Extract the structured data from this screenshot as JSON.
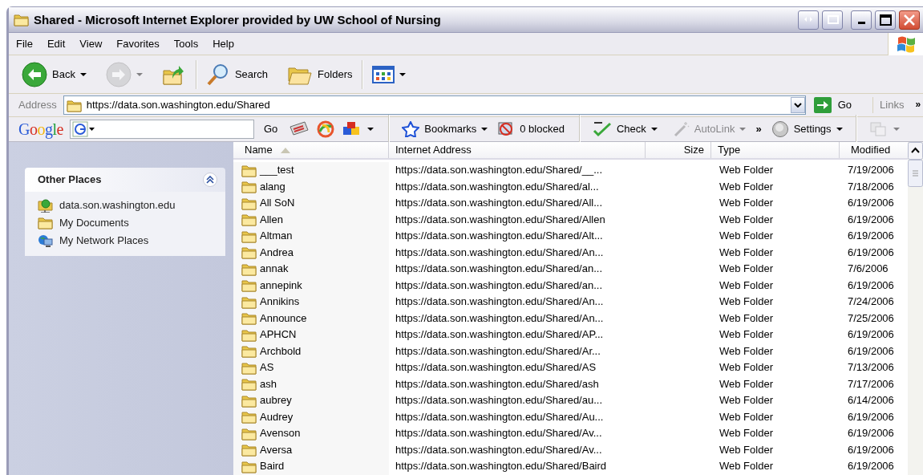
{
  "window": {
    "title": "Shared - Microsoft Internet Explorer provided by UW School of Nursing"
  },
  "menu": [
    {
      "label": "File"
    },
    {
      "label": "Edit"
    },
    {
      "label": "View"
    },
    {
      "label": "Favorites"
    },
    {
      "label": "Tools"
    },
    {
      "label": "Help"
    }
  ],
  "toolbar": {
    "groups": [
      {
        "buttons": [
          {
            "kind": "back",
            "label": "Back",
            "disabled": false,
            "dropdown": true
          },
          {
            "kind": "forward",
            "disabled": true,
            "dropdown": true
          },
          {
            "kind": "up",
            "disabled": false,
            "dropdown": false
          }
        ]
      },
      {
        "buttons": [
          {
            "kind": "search",
            "label": "Search",
            "disabled": false,
            "dropdown": false
          },
          {
            "kind": "folders",
            "label": "Folders",
            "disabled": false,
            "dropdown": false
          }
        ]
      },
      {
        "buttons": [
          {
            "kind": "views",
            "disabled": false,
            "dropdown": true
          }
        ]
      }
    ]
  },
  "address": {
    "label": "Address",
    "value": "https://data.son.washington.edu/Shared",
    "go": "Go",
    "links": "Links",
    "more": "»"
  },
  "google": {
    "logo": "Google",
    "go": "Go",
    "items": [
      {
        "kind": "bookmarks",
        "label": "Bookmarks",
        "disabled": false,
        "dropdown": true
      },
      {
        "kind": "blocked",
        "label": "0 blocked",
        "disabled": false,
        "dropdown": false
      },
      {
        "kind": "check",
        "label": "Check",
        "disabled": false,
        "dropdown": true
      },
      {
        "kind": "autolink",
        "label": "AutoLink",
        "disabled": true,
        "dropdown": true
      },
      {
        "kind": "more",
        "label": "»",
        "disabled": false,
        "dropdown": false
      },
      {
        "kind": "settings",
        "label": "Settings",
        "disabled": false,
        "dropdown": true
      },
      {
        "kind": "translate",
        "disabled": true,
        "dropdown": true
      }
    ]
  },
  "sidebar": {
    "title": "Other Places",
    "expanded": true,
    "items": [
      {
        "kind": "site",
        "label": "data.son.washington.edu"
      },
      {
        "kind": "documents",
        "label": "My Documents"
      },
      {
        "kind": "network",
        "label": "My Network Places"
      }
    ]
  },
  "table": {
    "columns": [
      {
        "label": "Name",
        "sorted": true
      },
      {
        "label": "Internet Address",
        "sorted": false
      },
      {
        "label": "Size",
        "sorted": false
      },
      {
        "label": "Type",
        "sorted": false
      },
      {
        "label": "Modified",
        "sorted": false
      }
    ],
    "rows": [
      {
        "name": "___test",
        "address": "https://data.son.washington.edu/Shared/__...",
        "type": "Web Folder",
        "modified": "7/19/2006"
      },
      {
        "name": "alang",
        "address": "https://data.son.washington.edu/Shared/al...",
        "type": "Web Folder",
        "modified": "7/18/2006"
      },
      {
        "name": "All SoN",
        "address": "https://data.son.washington.edu/Shared/All...",
        "type": "Web Folder",
        "modified": "6/19/2006"
      },
      {
        "name": "Allen",
        "address": "https://data.son.washington.edu/Shared/Allen",
        "type": "Web Folder",
        "modified": "6/19/2006"
      },
      {
        "name": "Altman",
        "address": "https://data.son.washington.edu/Shared/Alt...",
        "type": "Web Folder",
        "modified": "6/19/2006"
      },
      {
        "name": "Andrea",
        "address": "https://data.son.washington.edu/Shared/An...",
        "type": "Web Folder",
        "modified": "6/19/2006"
      },
      {
        "name": "annak",
        "address": "https://data.son.washington.edu/Shared/an...",
        "type": "Web Folder",
        "modified": "7/6/2006"
      },
      {
        "name": "annepink",
        "address": "https://data.son.washington.edu/Shared/an...",
        "type": "Web Folder",
        "modified": "6/19/2006"
      },
      {
        "name": "Annikins",
        "address": "https://data.son.washington.edu/Shared/An...",
        "type": "Web Folder",
        "modified": "7/24/2006"
      },
      {
        "name": "Announce",
        "address": "https://data.son.washington.edu/Shared/An...",
        "type": "Web Folder",
        "modified": "7/25/2006"
      },
      {
        "name": "APHCN",
        "address": "https://data.son.washington.edu/Shared/AP...",
        "type": "Web Folder",
        "modified": "6/19/2006"
      },
      {
        "name": "Archbold",
        "address": "https://data.son.washington.edu/Shared/Ar...",
        "type": "Web Folder",
        "modified": "6/19/2006"
      },
      {
        "name": "AS",
        "address": "https://data.son.washington.edu/Shared/AS",
        "type": "Web Folder",
        "modified": "7/13/2006"
      },
      {
        "name": "ash",
        "address": "https://data.son.washington.edu/Shared/ash",
        "type": "Web Folder",
        "modified": "7/17/2006"
      },
      {
        "name": "aubrey",
        "address": "https://data.son.washington.edu/Shared/au...",
        "type": "Web Folder",
        "modified": "6/14/2006"
      },
      {
        "name": "Audrey",
        "address": "https://data.son.washington.edu/Shared/Au...",
        "type": "Web Folder",
        "modified": "6/19/2006"
      },
      {
        "name": "Avenson",
        "address": "https://data.son.washington.edu/Shared/Av...",
        "type": "Web Folder",
        "modified": "6/19/2006"
      },
      {
        "name": "Aversa",
        "address": "https://data.son.washington.edu/Shared/Av...",
        "type": "Web Folder",
        "modified": "6/19/2006"
      },
      {
        "name": "Baird",
        "address": "https://data.son.washington.edu/Shared/Baird",
        "type": "Web Folder",
        "modified": "6/19/2006"
      }
    ]
  }
}
